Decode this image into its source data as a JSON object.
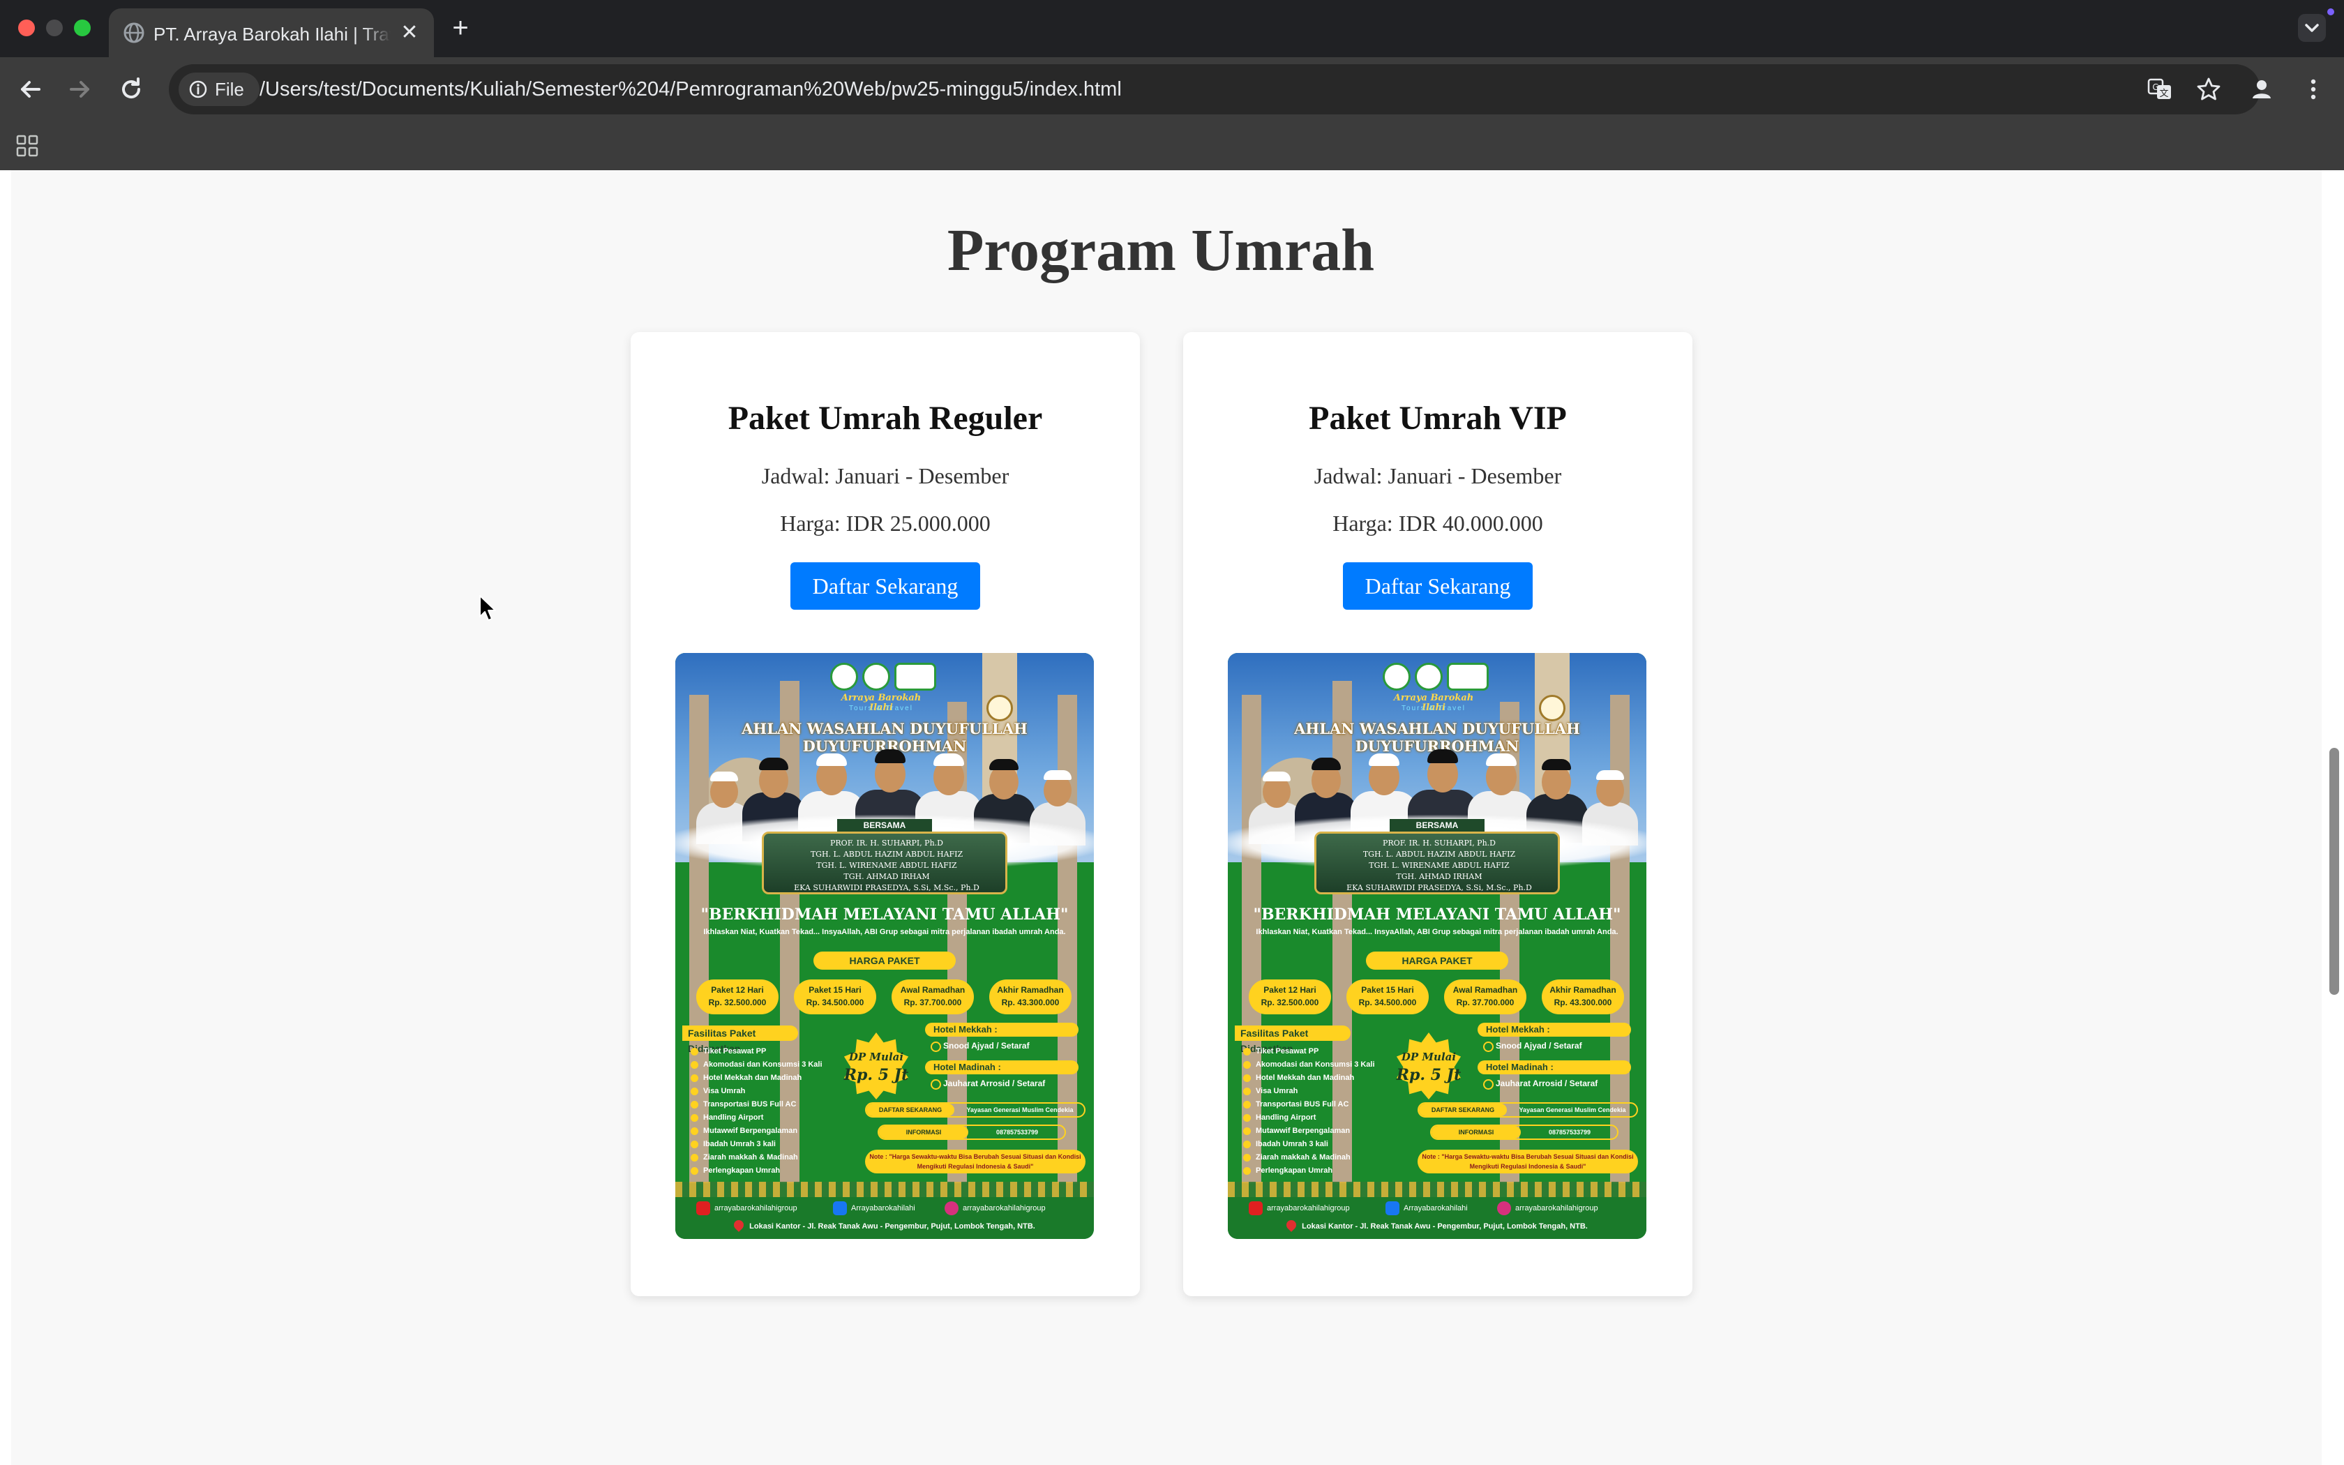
{
  "browser": {
    "tab_title": "PT. Arraya Barokah Ilahi | Travel",
    "new_tab_symbol": "+",
    "close_symbol": "✕",
    "site_chip_label": "File",
    "url": "/Users/test/Documents/Kuliah/Semester%204/Pemrograman%20Web/pw25-minggu5/index.html"
  },
  "page": {
    "section_title": "Program Umrah",
    "cards": [
      {
        "title": "Paket Umrah Reguler",
        "schedule": "Jadwal: Januari - Desember",
        "price": "Harga: IDR 25.000.000",
        "button_label": "Daftar Sekarang"
      },
      {
        "title": "Paket Umrah VIP",
        "schedule": "Jadwal: Januari - Desember",
        "price": "Harga: IDR 40.000.000",
        "button_label": "Daftar Sekarang"
      }
    ]
  },
  "poster": {
    "brand": "Arraya Barokah Ilahi",
    "brand_sub": "Tours & Travel",
    "headline": "AHLAN WASAHLAN DUYUFULLAH DUYUFURROHMAN",
    "bersama": "BERSAMA",
    "names": [
      "PROF. IR. H. SUHARPI, Ph.D",
      "TGH. L. ABDUL HAZIM ABDUL HAFIZ",
      "TGH. L. WIRENAME ABDUL HAFIZ",
      "TGH. AHMAD IRHAM",
      "EKA SUHARWIDI PRASEDYA, S.Si, M.Sc., Ph.D"
    ],
    "slogan": "\"BERKHIDMAH MELAYANI TAMU ALLAH\"",
    "slogan_sub": "Ikhlaskan Niat, Kuatkan Tekad... InsyaAllah, ABI Grup sebagai mitra perjalanan ibadah umrah Anda.",
    "price_heading": "HARGA PAKET",
    "packages": [
      {
        "name": "Paket 12 Hari",
        "price": "Rp. 32.500.000"
      },
      {
        "name": "Paket 15 Hari",
        "price": "Rp. 34.500.000"
      },
      {
        "name": "Awal Ramadhan",
        "price": "Rp. 37.700.000"
      },
      {
        "name": "Akhir Ramadhan",
        "price": "Rp. 43.300.000"
      }
    ],
    "facilities_heading": "Fasilitas Paket Didapatkan",
    "facilities": [
      "Tiket Pesawat PP",
      "Akomodasi dan Konsumsi 3 Kali",
      "Hotel Mekkah dan Madinah",
      "Visa Umrah",
      "Transportasi BUS Full AC",
      "Handling Airport",
      "Mutawwif Berpengalaman",
      "Ibadah Umrah 3 kali",
      "Ziarah makkah & Madinah",
      "Perlengkapan Umrah"
    ],
    "dp_line1": "DP Mulai",
    "dp_line2": "Rp. 5 Jt",
    "hotel_mekkah_heading": "Hotel Mekkah :",
    "hotel_mekkah": "Snood Ajyad / Setaraf",
    "hotel_madinah_heading": "Hotel Madinah :",
    "hotel_madinah": "Jauharat Arrosid / Setaraf",
    "register_tag": "DAFTAR SEKARANG",
    "register_value": "Yayasan Generasi Muslim Cendekia",
    "info_tag": "INFORMASI",
    "info_value": "087857533799",
    "note": "Note : \"Harga Sewaktu-waktu Bisa Berubah Sesuai Situasi dan Kondisi Mengikuti Regulasi Indonesia & Saudi\"",
    "social_youtube": "arrayabarokahilahigroup",
    "social_facebook": "Arrayabarokahilahi",
    "social_instagram": "arrayabarokahilahigroup",
    "address": "Lokasi Kantor - Jl. Reak Tanak Awu - Pengembur, Pujut, Lombok Tengah, NTB."
  },
  "colors": {
    "button_blue": "#007bff",
    "poster_green": "#1a8a2c",
    "poster_yellow": "#ffd21f"
  }
}
